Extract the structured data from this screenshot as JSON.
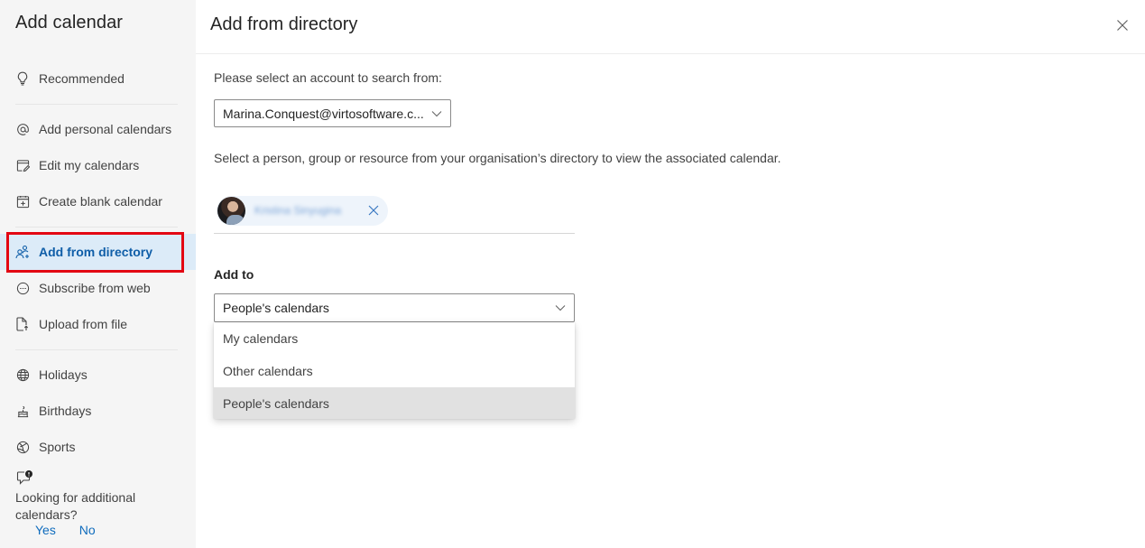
{
  "sidebar": {
    "title": "Add calendar",
    "items": [
      {
        "label": "Recommended",
        "icon": "lightbulb-icon"
      },
      {
        "label": "Add personal calendars",
        "icon": "at-sign-icon"
      },
      {
        "label": "Edit my calendars",
        "icon": "edit-calendar-icon"
      },
      {
        "label": "Create blank calendar",
        "icon": "calendar-add-icon"
      },
      {
        "label": "Add from directory",
        "icon": "people-add-icon",
        "selected": true
      },
      {
        "label": "Subscribe from web",
        "icon": "link-circle-icon"
      },
      {
        "label": "Upload from file",
        "icon": "file-upload-icon"
      },
      {
        "label": "Holidays",
        "icon": "globe-icon"
      },
      {
        "label": "Birthdays",
        "icon": "cake-icon"
      },
      {
        "label": "Sports",
        "icon": "sports-ball-icon"
      }
    ],
    "feedback": {
      "icon": "feedback-alert-icon",
      "question": "Looking for additional calendars?",
      "yes": "Yes",
      "no": "No"
    }
  },
  "main": {
    "title": "Add from directory",
    "close_icon": "close-icon",
    "account_prompt": "Please select an account to search from:",
    "account_value": "Marina.Conquest@virtosoftware.c...",
    "directory_prompt": "Select a person, group or resource from your organisation’s directory to view the associated calendar.",
    "selected_person": "Kristina Sinyugina",
    "add_to_label": "Add to",
    "add_to_value": "People's calendars",
    "add_to_options": [
      {
        "label": "My calendars"
      },
      {
        "label": "Other calendars"
      },
      {
        "label": "People's calendars",
        "selected": true
      }
    ]
  },
  "colors": {
    "accent": "#0f6cbd",
    "selected_bg": "#dcebf8",
    "highlight_outline": "#e30613"
  }
}
